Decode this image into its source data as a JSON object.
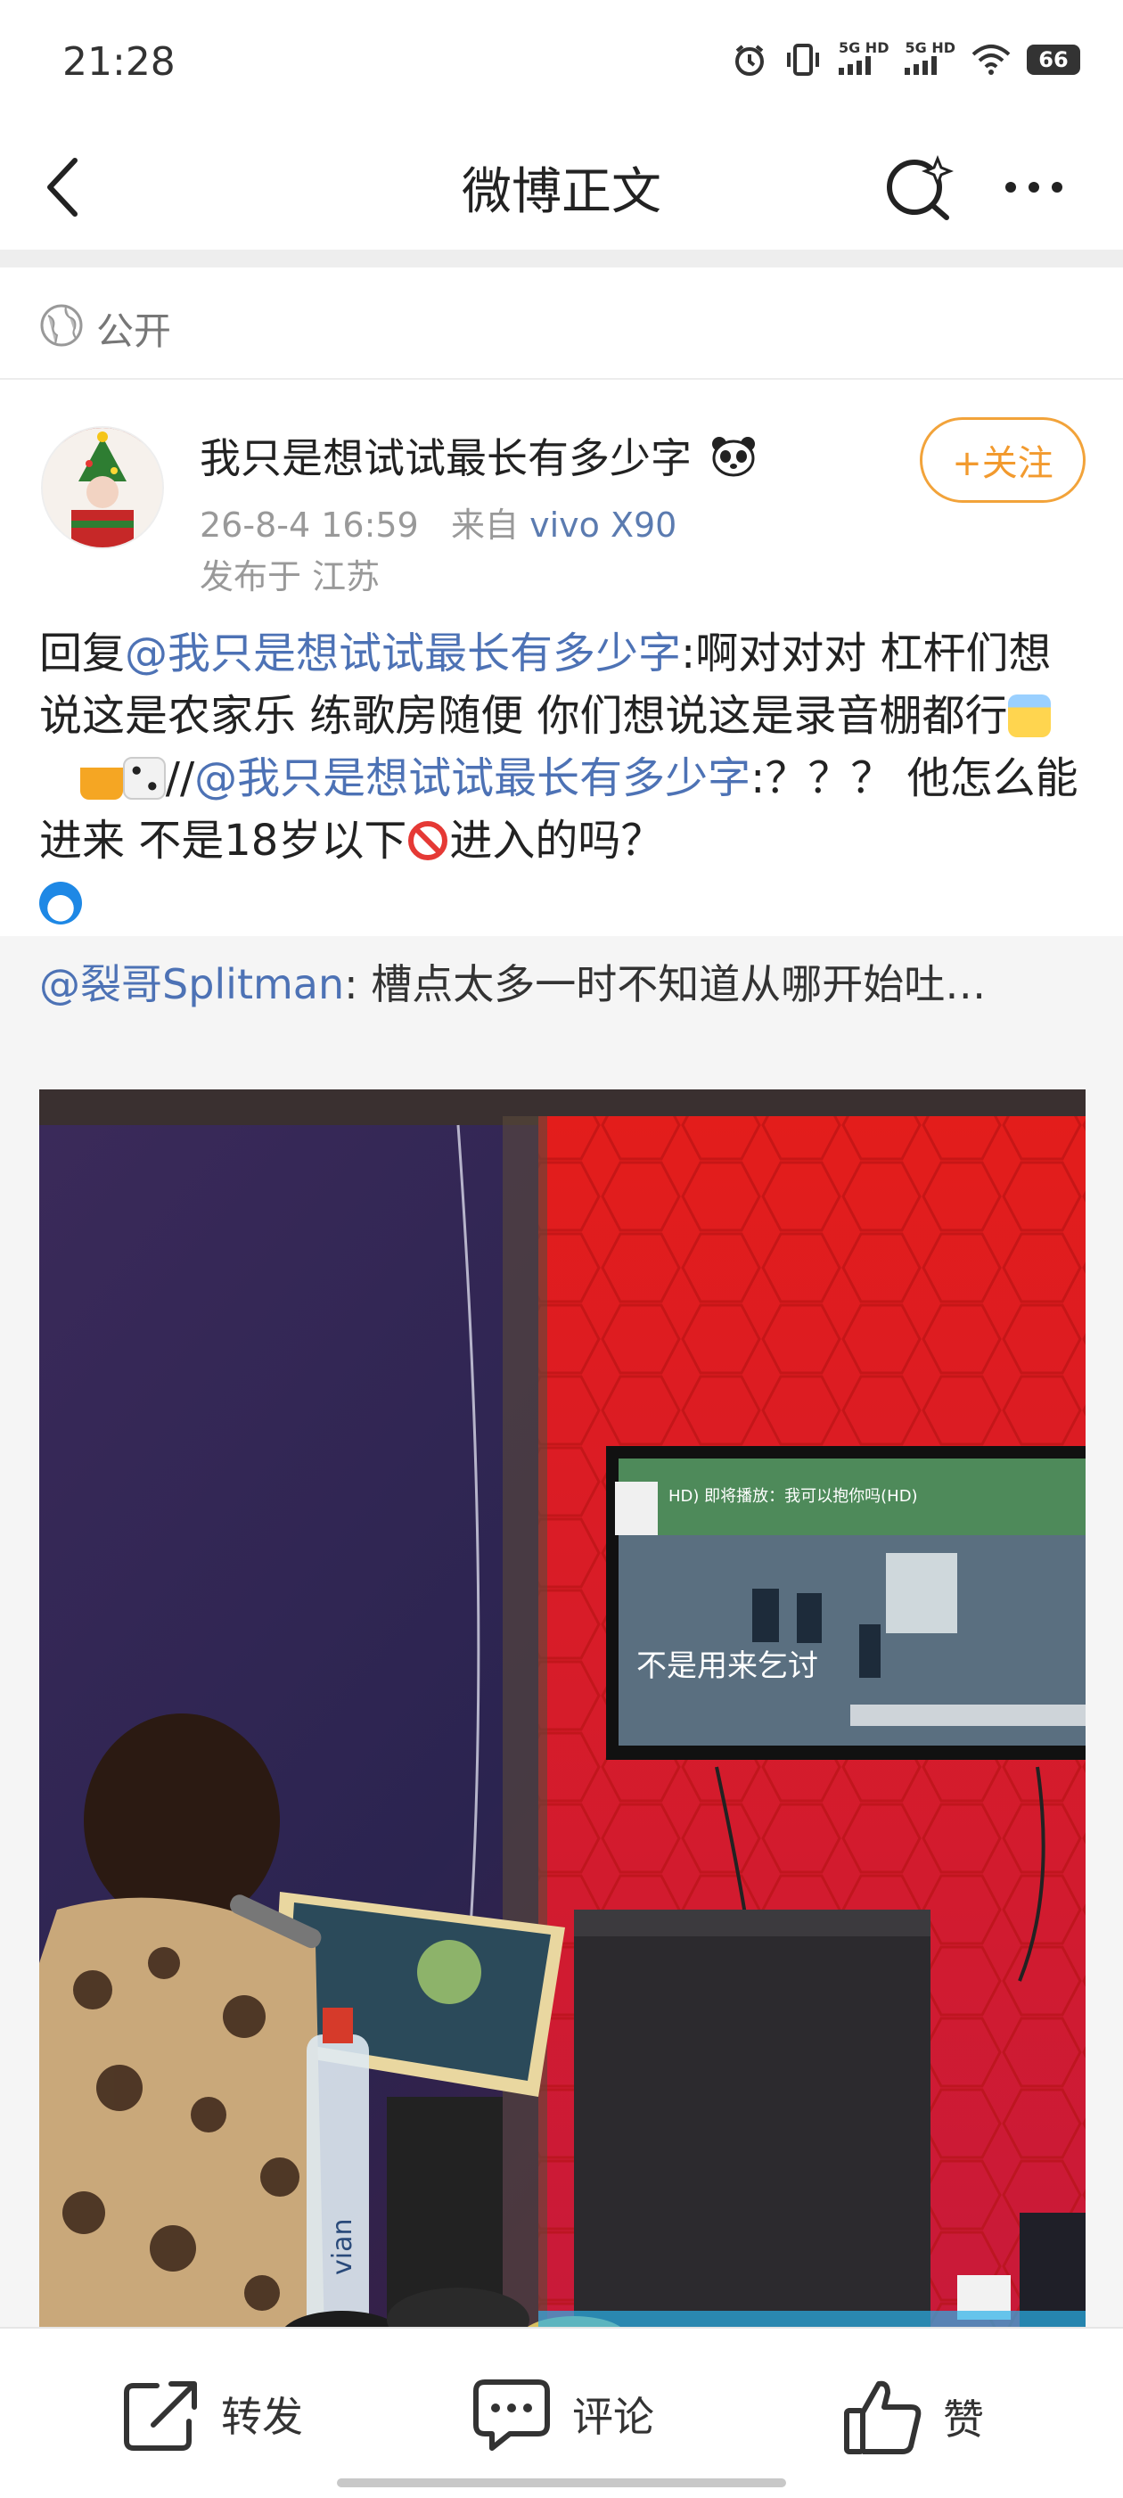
{
  "status_bar": {
    "time": "21:28",
    "network_1": "5G HD",
    "network_2": "5G HD",
    "battery": "66"
  },
  "nav": {
    "title": "微博正文"
  },
  "visibility": {
    "label": "公开"
  },
  "post": {
    "username": "我只是想试试最长有多少字",
    "time": "26-8-4 16:59",
    "source_prefix": "来自",
    "device": "vivo X90",
    "location": "发布于 江苏",
    "follow_label": "+关注",
    "body": {
      "p1": "回复",
      "mention1": "@我只是想试试最长有多少字",
      "p2": ":啊对对对 杠杆们想说这是农家乐 练歌房随便 你们想说这是录音棚都行",
      "p3": "//",
      "mention2": "@我只是想试试最长有多少字",
      "p4": ":？？？ 他怎么能进来 不是18岁以下",
      "p5": "进入的吗？"
    }
  },
  "quote": {
    "author": "@裂哥Splitman",
    "sep": ":",
    "text": " 槽点太多一时不知道从哪开始吐…"
  },
  "photo": {
    "tv_top_text": "HD) 即将播放：我可以抱你吗(HD)",
    "tv_subtitle": "不是用来乞讨",
    "bottle_text": "vian"
  },
  "actions": {
    "repost": "转发",
    "comment": "评论",
    "like": "赞"
  },
  "colors": {
    "accent": "#f29a2e",
    "link": "#4d72b5",
    "red_wall": "#e0201e"
  }
}
